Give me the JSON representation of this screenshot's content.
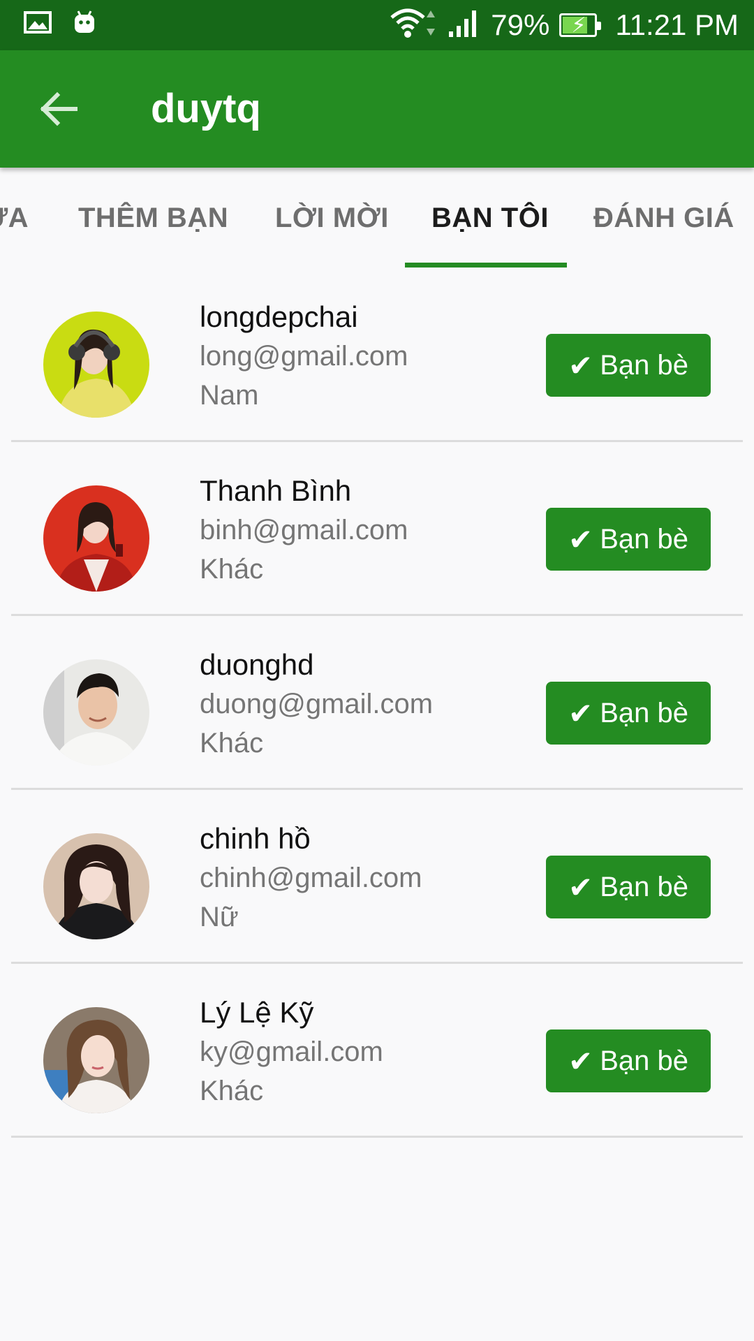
{
  "status_bar": {
    "battery": "79%",
    "battery_level": 0.79,
    "time": "11:21 PM",
    "icons": [
      "gallery-icon",
      "android-icon",
      "wifi-icon",
      "signal-icon",
      "battery-charging-icon"
    ]
  },
  "app_bar": {
    "title": "duytq",
    "back_icon": "arrow-left-icon"
  },
  "tabs": [
    {
      "label": "ỬA",
      "active": false
    },
    {
      "label": "THÊM BẠN",
      "active": false
    },
    {
      "label": "LỜI MỜI",
      "active": false
    },
    {
      "label": "BẠN TÔI",
      "active": true
    },
    {
      "label": "ĐÁNH GIÁ",
      "active": false
    }
  ],
  "friends": [
    {
      "name": "longdepchai",
      "email": "long@gmail.com",
      "gender": "Nam",
      "button": "Bạn bè"
    },
    {
      "name": "Thanh Bình",
      "email": "binh@gmail.com",
      "gender": "Khác",
      "button": "Bạn bè"
    },
    {
      "name": "duonghd",
      "email": "duong@gmail.com",
      "gender": "Khác",
      "button": "Bạn bè"
    },
    {
      "name": "chinh hồ",
      "email": "chinh@gmail.com",
      "gender": "Nữ",
      "button": "Bạn bè"
    },
    {
      "name": "Lý Lệ Kỹ",
      "email": "ky@gmail.com",
      "gender": "Khác",
      "button": "Bạn bè"
    }
  ],
  "colors": {
    "status_bar": "#166818",
    "primary": "#248c22",
    "background": "#f9f9fa",
    "tab_active_text": "#1c1c1c",
    "tab_inactive_text": "#6e6e6e",
    "secondary_text": "#757575"
  }
}
